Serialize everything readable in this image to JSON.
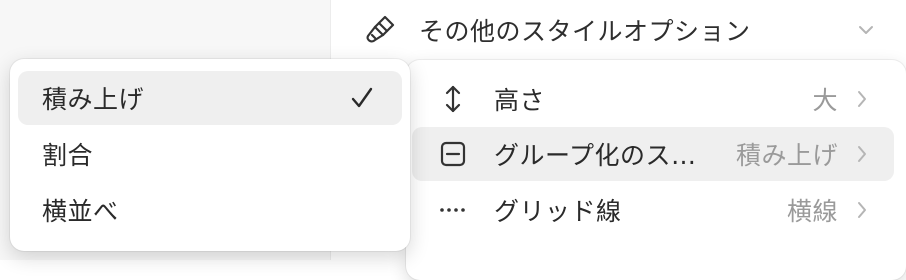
{
  "section": {
    "title": "その他のスタイルオプション",
    "brush_icon": "paintbrush-icon",
    "chevron_icon": "chevron-down-icon"
  },
  "menu": {
    "items": [
      {
        "label": "高さ",
        "value": "大",
        "icon": "vertical-arrows-icon",
        "hovered": false
      },
      {
        "label": "グループ化のス…",
        "value": "積み上げ",
        "icon": "split-square-icon",
        "hovered": true
      },
      {
        "label": "グリッド線",
        "value": "横線",
        "icon": "dotted-line-icon",
        "hovered": false
      }
    ]
  },
  "submenu": {
    "options": [
      {
        "label": "積み上げ",
        "selected": true
      },
      {
        "label": "割合",
        "selected": false
      },
      {
        "label": "横並べ",
        "selected": false
      }
    ]
  },
  "colors": {
    "hover_bg": "#efefef",
    "value_text": "#9a9a9a",
    "panel_bg": "#f7f7f7"
  }
}
